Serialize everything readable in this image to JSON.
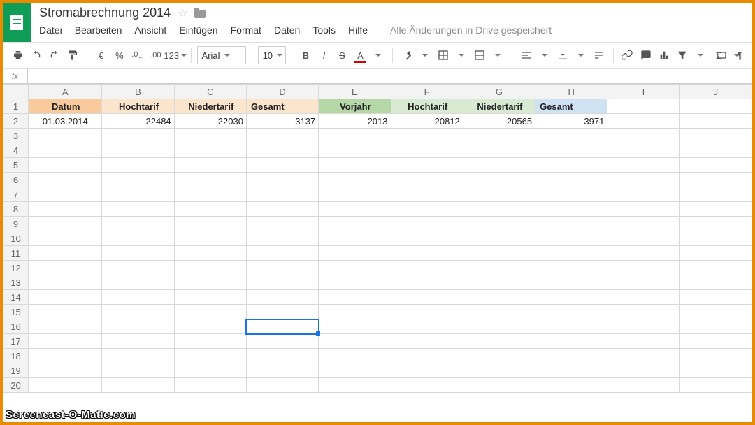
{
  "doc": {
    "title": "Stromabrechnung 2014",
    "save_status": "Alle Änderungen in Drive gespeichert"
  },
  "menu": {
    "file": "Datei",
    "edit": "Bearbeiten",
    "view": "Ansicht",
    "insert": "Einfügen",
    "format": "Format",
    "data": "Daten",
    "tools": "Tools",
    "help": "Hilfe"
  },
  "toolbar": {
    "euro": "€",
    "percent": "%",
    "dec_dec": ".0",
    "dec_inc": ".00",
    "num_format": "123",
    "font": "Arial",
    "size": "10",
    "bold": "B",
    "italic": "I",
    "strike": "S",
    "text_color": "A"
  },
  "fx": {
    "label": "fx",
    "value": ""
  },
  "columns": [
    "A",
    "B",
    "C",
    "D",
    "E",
    "F",
    "G",
    "H",
    "I",
    "J"
  ],
  "row_count": 20,
  "headers": {
    "A": {
      "text": "Datum",
      "bg": "bg-orange",
      "align": "center"
    },
    "B": {
      "text": "Hochtarif",
      "bg": "bg-lorange",
      "align": "center"
    },
    "C": {
      "text": "Niedertarif",
      "bg": "bg-lorange",
      "align": "center"
    },
    "D": {
      "text": "Gesamt",
      "bg": "bg-lorange",
      "align": "left"
    },
    "E": {
      "text": "Vorjahr",
      "bg": "bg-green",
      "align": "center"
    },
    "F": {
      "text": "Hochtarif",
      "bg": "bg-lgreen",
      "align": "center"
    },
    "G": {
      "text": "Niedertarif",
      "bg": "bg-lgreen",
      "align": "center"
    },
    "H": {
      "text": "Gesamt",
      "bg": "bg-lblue",
      "align": "left"
    }
  },
  "data_row": {
    "A": "01.03.2014",
    "B": "22484",
    "C": "22030",
    "D": "3137",
    "E": "2013",
    "F": "20812",
    "G": "20565",
    "H": "3971"
  },
  "selected": {
    "col": "D",
    "row": 16
  },
  "watermark": "Screencast-O-Matic.com",
  "chart_data": {
    "type": "table",
    "title": "Stromabrechnung 2014",
    "columns": [
      "Datum",
      "Hochtarif",
      "Niedertarif",
      "Gesamt",
      "Vorjahr",
      "Hochtarif",
      "Niedertarif",
      "Gesamt"
    ],
    "rows": [
      [
        "01.03.2014",
        22484,
        22030,
        3137,
        2013,
        20812,
        20565,
        3971
      ]
    ]
  }
}
